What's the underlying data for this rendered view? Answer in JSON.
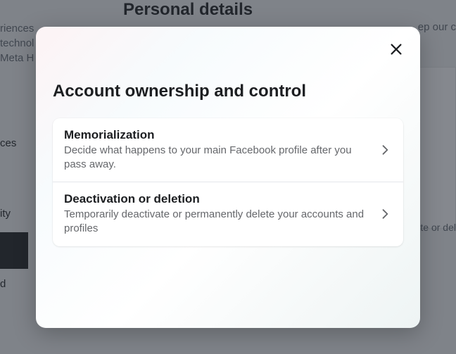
{
  "background": {
    "heading": "Personal details",
    "text_left_1": "riences",
    "text_left_2": "technol",
    "text_left_3": "Meta H",
    "text_right": "ep our c",
    "sidebar_item_1": "ces",
    "sidebar_item_2": "ity",
    "sidebar_item_3": "d",
    "box_text": "te or del"
  },
  "modal": {
    "title": "Account ownership and control",
    "items": [
      {
        "title": "Memorialization",
        "description": "Decide what happens to your main Facebook profile after you pass away."
      },
      {
        "title": "Deactivation or deletion",
        "description": "Temporarily deactivate or permanently delete your accounts and profiles"
      }
    ]
  }
}
